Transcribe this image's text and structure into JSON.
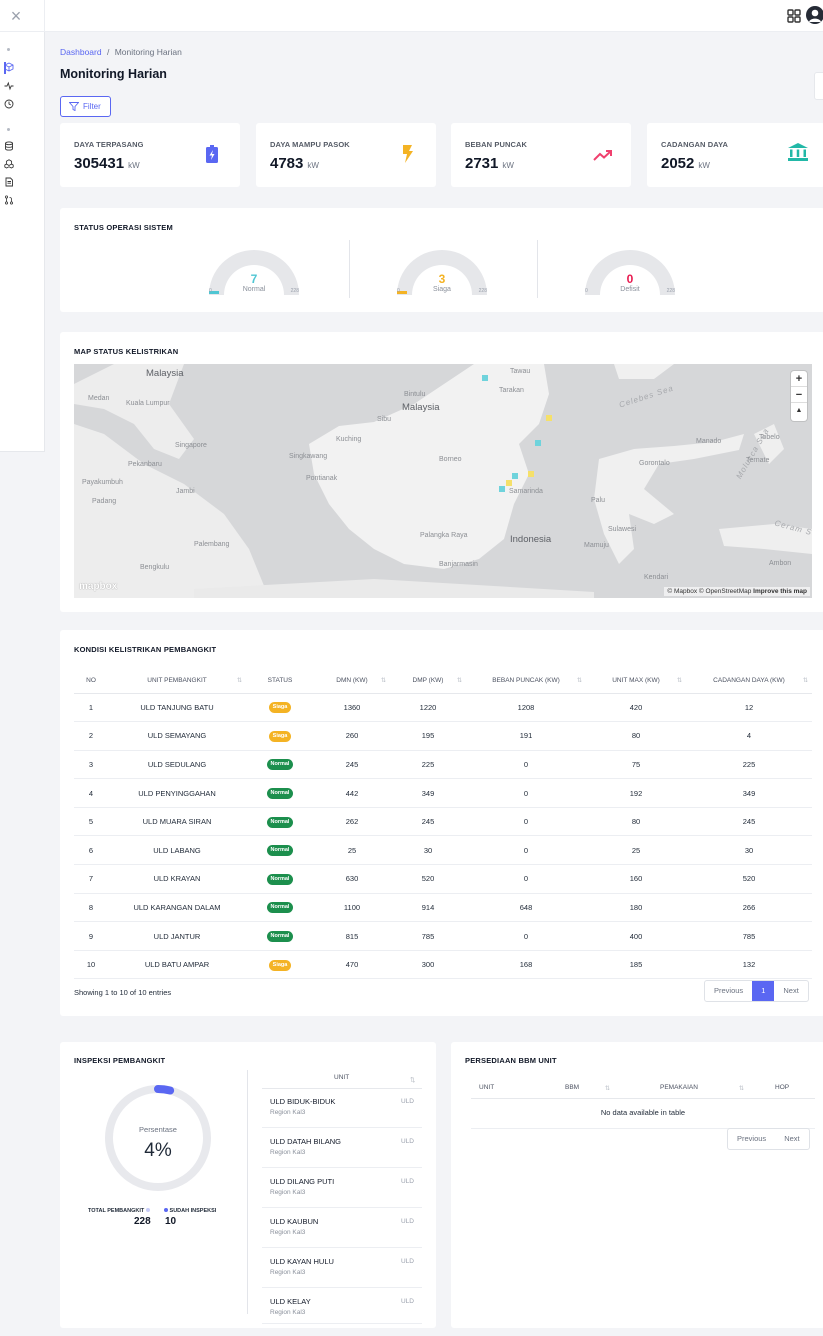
{
  "breadcrumb": {
    "home": "Dashboard",
    "separator": "/",
    "current": "Monitoring Harian"
  },
  "page_title": "Monitoring Harian",
  "filter_label": "Filter",
  "stats": [
    {
      "label": "DAYA TERPASANG",
      "value": "305431",
      "unit": "kW",
      "icon": "battery-charging-icon",
      "color": "#5a67f2"
    },
    {
      "label": "DAYA MAMPU PASOK",
      "value": "4783",
      "unit": "kW",
      "icon": "lightning-icon",
      "color": "#f4b324"
    },
    {
      "label": "BEBAN PUNCAK",
      "value": "2731",
      "unit": "kW",
      "icon": "trend-up-icon",
      "color": "#f0406e"
    },
    {
      "label": "CADANGAN DAYA",
      "value": "2052",
      "unit": "kW",
      "icon": "bank-icon",
      "color": "#22b8a7"
    }
  ],
  "status_operasi": {
    "title": "STATUS OPERASI SISTEM",
    "gauges": [
      {
        "value": "7",
        "label": "Normal",
        "min": "0",
        "max": "228",
        "fraction": 0.031,
        "color": "#4fc6d3"
      },
      {
        "value": "3",
        "label": "Siaga",
        "min": "0",
        "max": "228",
        "fraction": 0.013,
        "color": "#f4b324"
      },
      {
        "value": "0",
        "label": "Defisit",
        "min": "0",
        "max": "228",
        "fraction": 0.0,
        "color": "#e8194f"
      }
    ]
  },
  "map": {
    "title": "MAP STATUS KELISTRIKAN",
    "places": [
      "Malaysia",
      "Medan",
      "Kuala Lumpur",
      "Singapore",
      "Pekanbaru",
      "Payakumbuh",
      "Padang",
      "Jambi",
      "Palembang",
      "Bengkulu",
      "Bintulu",
      "Malaysia",
      "Sibu",
      "Kuching",
      "Singkawang",
      "Pontianak",
      "Borneo",
      "Palangka Raya",
      "Banjarmasin",
      "Indonesia",
      "Samarinda",
      "Tawau",
      "Tarakan",
      "Celebes Sea",
      "Manado",
      "Tobelo",
      "Molucca Sea",
      "Gorontalo",
      "Ternate",
      "Palu",
      "Sulawesi",
      "Mamuju",
      "Ceram Se",
      "Ambon",
      "Kendari"
    ],
    "zoom_in": "+",
    "zoom_out": "−",
    "compass": "▲",
    "logo": "mapbox",
    "attribution_pre": "© Mapbox © OpenStreetMap",
    "attribution_link": "Improve this map"
  },
  "kondisi": {
    "title": "KONDISI KELISTRIKAN PEMBANGKIT",
    "columns": [
      "NO",
      "UNIT PEMBANGKIT",
      "STATUS",
      "DMN (KW)",
      "DMP (KW)",
      "BEBAN PUNCAK (KW)",
      "UNIT MAX (KW)",
      "CADANGAN DAYA (KW)"
    ],
    "sort_icon": "⇅",
    "rows": [
      {
        "no": "1",
        "unit": "ULD TANJUNG BATU",
        "status": "Siaga",
        "dmn": "1360",
        "dmp": "1220",
        "beban": "1208",
        "max": "420",
        "cadangan": "12"
      },
      {
        "no": "2",
        "unit": "ULD SEMAYANG",
        "status": "Siaga",
        "dmn": "260",
        "dmp": "195",
        "beban": "191",
        "max": "80",
        "cadangan": "4"
      },
      {
        "no": "3",
        "unit": "ULD SEDULANG",
        "status": "Normal",
        "dmn": "245",
        "dmp": "225",
        "beban": "0",
        "max": "75",
        "cadangan": "225"
      },
      {
        "no": "4",
        "unit": "ULD PENYINGGAHAN",
        "status": "Normal",
        "dmn": "442",
        "dmp": "349",
        "beban": "0",
        "max": "192",
        "cadangan": "349"
      },
      {
        "no": "5",
        "unit": "ULD MUARA SIRAN",
        "status": "Normal",
        "dmn": "262",
        "dmp": "245",
        "beban": "0",
        "max": "80",
        "cadangan": "245"
      },
      {
        "no": "6",
        "unit": "ULD LABANG",
        "status": "Normal",
        "dmn": "25",
        "dmp": "30",
        "beban": "0",
        "max": "25",
        "cadangan": "30"
      },
      {
        "no": "7",
        "unit": "ULD KRAYAN",
        "status": "Normal",
        "dmn": "630",
        "dmp": "520",
        "beban": "0",
        "max": "160",
        "cadangan": "520"
      },
      {
        "no": "8",
        "unit": "ULD KARANGAN DALAM",
        "status": "Normal",
        "dmn": "1100",
        "dmp": "914",
        "beban": "648",
        "max": "180",
        "cadangan": "266"
      },
      {
        "no": "9",
        "unit": "ULD JANTUR",
        "status": "Normal",
        "dmn": "815",
        "dmp": "785",
        "beban": "0",
        "max": "400",
        "cadangan": "785"
      },
      {
        "no": "10",
        "unit": "ULD BATU AMPAR",
        "status": "Siaga",
        "dmn": "470",
        "dmp": "300",
        "beban": "168",
        "max": "185",
        "cadangan": "132"
      }
    ],
    "showing": "Showing 1 to 10 of 10 entries",
    "pager": {
      "prev": "Previous",
      "page": "1",
      "next": "Next"
    }
  },
  "inspeksi": {
    "title": "INSPEKSI PEMBANGKIT",
    "donut_label": "Persentase",
    "percent": "4%",
    "percent_value": 4,
    "total_label": "TOTAL PEMBANGKIT",
    "total_value": "228",
    "done_label": "SUDAH INSPEKSI",
    "done_value": "10",
    "list_header": "UNIT",
    "items": [
      {
        "name": "ULD BIDUK-BIDUK",
        "region": "Region Kal3",
        "tag": "ULD"
      },
      {
        "name": "ULD DATAH BILANG",
        "region": "Region Kal3",
        "tag": "ULD"
      },
      {
        "name": "ULD DILANG PUTI",
        "region": "Region Kal3",
        "tag": "ULD"
      },
      {
        "name": "ULD KAUBUN",
        "region": "Region Kal3",
        "tag": "ULD"
      },
      {
        "name": "ULD KAYAN HULU",
        "region": "Region Kal3",
        "tag": "ULD"
      },
      {
        "name": "ULD KELAY",
        "region": "Region Kal3",
        "tag": "ULD"
      }
    ],
    "accent": "#5a67f2"
  },
  "bbm": {
    "title": "PERSEDIAAN BBM UNIT",
    "columns": [
      "UNIT",
      "BBM",
      "PEMAKAIAN",
      "HOP"
    ],
    "empty": "No data available in table",
    "pager": {
      "prev": "Previous",
      "next": "Next"
    }
  }
}
